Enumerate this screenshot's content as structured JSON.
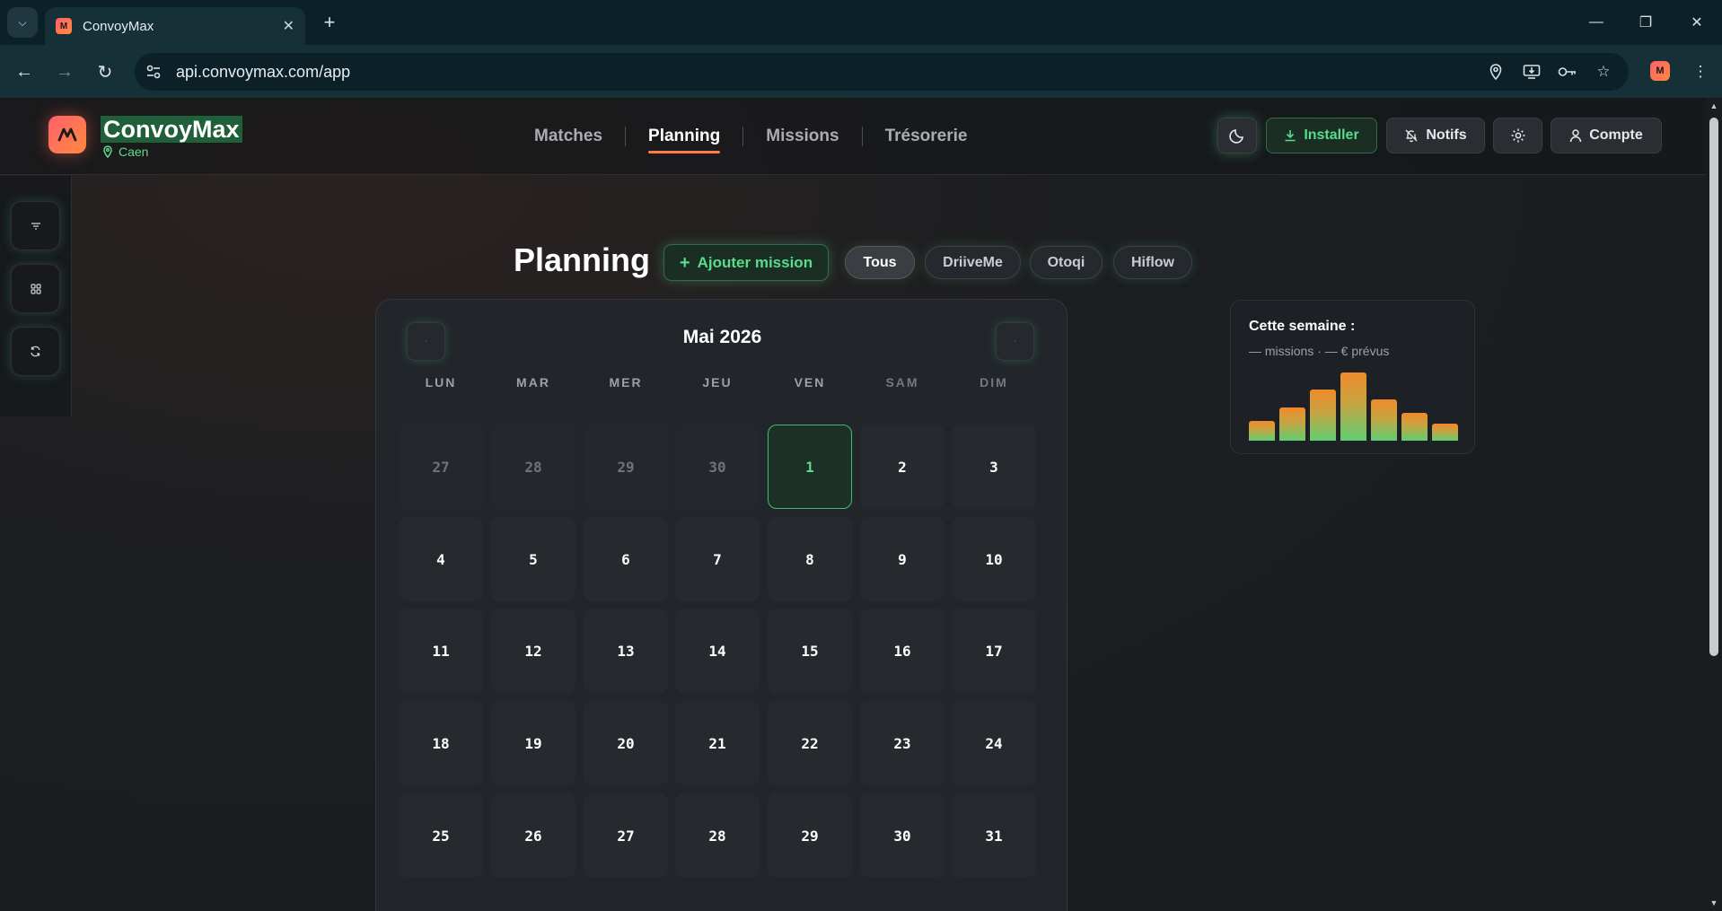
{
  "browser": {
    "tab_title": "ConvoyMax",
    "url": "api.convoymax.com/app",
    "favicon_letter": "M"
  },
  "header": {
    "brand": "ConvoyMax",
    "location": "Caen",
    "nav": [
      "Matches",
      "Planning",
      "Missions",
      "Trésorerie"
    ],
    "active_nav": "Planning",
    "install_label": "Installer",
    "notifs_label": "Notifs",
    "account_label": "Compte"
  },
  "page": {
    "title": "Planning",
    "add_mission_label": "Ajouter mission",
    "filters": [
      "Tous",
      "DriiveMe",
      "Otoqi",
      "Hiflow"
    ],
    "active_filter": "Tous"
  },
  "calendar": {
    "month_label": "Mai 2026",
    "weekdays": [
      "LUN",
      "MAR",
      "MER",
      "JEU",
      "VEN",
      "SAM",
      "DIM"
    ],
    "weeks": [
      [
        "27",
        "28",
        "29",
        "30",
        "1",
        "2",
        "3"
      ],
      [
        "4",
        "5",
        "6",
        "7",
        "8",
        "9",
        "10"
      ],
      [
        "11",
        "12",
        "13",
        "14",
        "15",
        "16",
        "17"
      ],
      [
        "18",
        "19",
        "20",
        "21",
        "22",
        "23",
        "24"
      ],
      [
        "25",
        "26",
        "27",
        "28",
        "29",
        "30",
        "31"
      ]
    ],
    "muted_cells": 4,
    "today": "1"
  },
  "week_summary": {
    "title": "Cette semaine :",
    "subtitle": "— missions · — € prévus",
    "bar_levels": [
      0.29,
      0.49,
      0.75,
      1.0,
      0.61,
      0.41,
      0.25
    ]
  },
  "colors": {
    "accent_green": "#59dc8b",
    "accent_orange": "#ff7a45",
    "background": "#1b1d20"
  }
}
